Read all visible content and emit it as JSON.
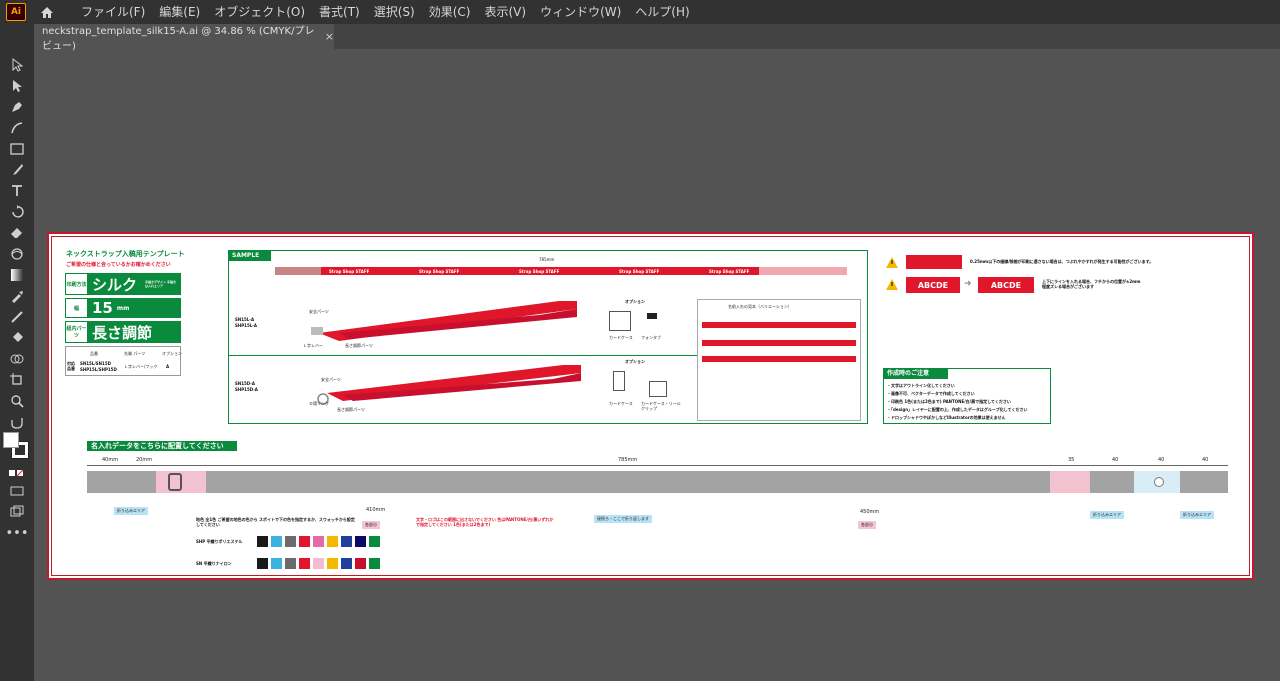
{
  "app": {
    "logo": "Ai"
  },
  "menu": [
    "ファイル(F)",
    "編集(E)",
    "オブジェクト(O)",
    "書式(T)",
    "選択(S)",
    "効果(C)",
    "表示(V)",
    "ウィンドウ(W)",
    "ヘルプ(H)"
  ],
  "tab": {
    "title": "neckstrap_template_silk15-A.ai @ 34.86 % (CMYK/プレビュー)",
    "close": "×"
  },
  "tools": [
    "selection-icon",
    "direct-selection-icon",
    "pen-icon",
    "curvature-icon",
    "rectangle-icon",
    "paintbrush-icon",
    "type-icon",
    "rotate-icon",
    "eraser-icon",
    "warp-icon",
    "gradient-icon",
    "eyedropper-icon",
    "blend-icon",
    "paint-bucket-icon",
    "shape-builder-icon",
    "artboard-icon",
    "zoom-icon",
    "hand-icon"
  ],
  "colors": {
    "accent_green": "#0a8a3c",
    "red": "#e0162b",
    "bar_gray": "#a3a3a3",
    "artboard_border": "#c21a2a"
  },
  "template": {
    "title": "ネックストラップ入稿用テンプレート",
    "subtitle": "ご希望の仕様と合っているかお確かめください",
    "spec": [
      {
        "label": "印刷方法",
        "value": "シルク",
        "note": "手描きデザイン 手描きは入れエリア"
      },
      {
        "label": "幅",
        "value": "15",
        "unit": "mm"
      },
      {
        "label": "紐内パーツ",
        "value": "長さ調節"
      }
    ],
    "compat_label": "対応品番",
    "models_a": "SN15L/SN15D",
    "models_b": "SHP15L/SHP15D",
    "col_headers": [
      "品番",
      "先端 パーツ",
      "オプション"
    ],
    "col_values": [
      "Ｌ字レバー/フック",
      "A"
    ]
  },
  "sample": {
    "label": "SAMPLE",
    "strap_text": "Strap Shop STAFF",
    "length": "785mm",
    "row1_model": "SN15L-A\nSHP15L-A",
    "row2_model": "SN15D-A\nSHP15D-A",
    "option_label": "オプション",
    "opt1": [
      "カードケース",
      "フォンタブ"
    ],
    "opt2": [
      "カードケース",
      "カードケース・リールクリップ"
    ],
    "variation_title": "名前入れの見本（バリエーション）",
    "parts1": [
      "Ｌ字レバー",
      "長さ調節パーツ",
      "安全パーツ"
    ],
    "parts2": [
      "Ｄ環リング",
      "長さ調節パーツ",
      "安全パーツ"
    ]
  },
  "warnings": {
    "w1": "0.25mm以下の細線/隙間が印刷に適さない場合は、つぶれやかすれが発生する可能性がございます。",
    "w2": "上下にラインを入れる場合、フチからの位置が±2mm程度ズレる場合がございます",
    "abc": "ABCDE"
  },
  "notes": {
    "title": "作成時のご注意",
    "items": [
      "・文字はアウトライン化してください",
      "・画像不可、ベクターデータで作成してください",
      "・印刷色 1色(または2色まで) PANTONE/白/黒で指定してください",
      "・「design」レイヤーに配置の上、作成したデータはグループ化してください",
      "・ドロップシャドウやぼかしなどIllustratorの効果は使えません"
    ]
  },
  "name_area": {
    "label": "名入れデータをこちらに配置してください",
    "dims": [
      "40mm",
      "20mm",
      "785mm",
      "35",
      "40",
      "40",
      "40"
    ],
    "tags": [
      "折り込みエリア",
      "接続ろ・ここで折り返します",
      "折り込みエリア",
      "折り込みエリア"
    ],
    "pink_tags": [
      "各部分",
      "各部分"
    ],
    "measure_a": "410mm",
    "measure_b": "450mm",
    "bg_color_note": "地色 全1色 ご希望の地色の色から スポイトで下の色を指定するか、スウォッチから設定してください",
    "text_note": "文字・ロゴはこの範囲に出さないでください 色はPANTONE/白/黒いずれかで指定してください 1色(または2色まで)",
    "row_shp": "SHP 平織りポリエステル",
    "row_sn": "SN 平織りナイロン",
    "swatches_shp": [
      "#1a1a1a",
      "#3bb3e0",
      "#6b6b6b",
      "#e0162b",
      "#e46aa8",
      "#f5b800",
      "#1f3f9a",
      "#0a0a6a",
      "#0a8a3c"
    ],
    "swatches_sn": [
      "#1a1a1a",
      "#3bb3e0",
      "#6b6b6b",
      "#e0162b",
      "#f3bcd0",
      "#f5b800",
      "#1f3f9a",
      "#c8102e",
      "#0a8a3c"
    ]
  }
}
